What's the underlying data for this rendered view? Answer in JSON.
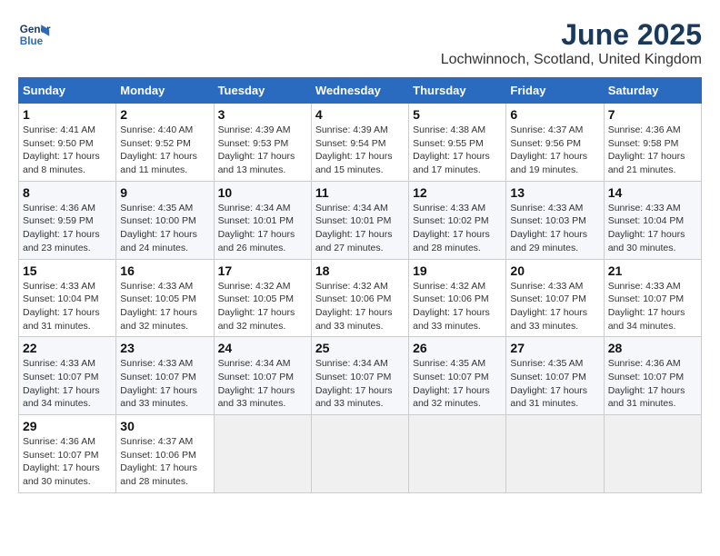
{
  "header": {
    "logo_line1": "General",
    "logo_line2": "Blue",
    "month": "June 2025",
    "location": "Lochwinnoch, Scotland, United Kingdom"
  },
  "weekdays": [
    "Sunday",
    "Monday",
    "Tuesday",
    "Wednesday",
    "Thursday",
    "Friday",
    "Saturday"
  ],
  "weeks": [
    [
      {
        "day": "1",
        "rise": "4:41 AM",
        "set": "9:50 PM",
        "daylight": "17 hours and 8 minutes."
      },
      {
        "day": "2",
        "rise": "4:40 AM",
        "set": "9:52 PM",
        "daylight": "17 hours and 11 minutes."
      },
      {
        "day": "3",
        "rise": "4:39 AM",
        "set": "9:53 PM",
        "daylight": "17 hours and 13 minutes."
      },
      {
        "day": "4",
        "rise": "4:39 AM",
        "set": "9:54 PM",
        "daylight": "17 hours and 15 minutes."
      },
      {
        "day": "5",
        "rise": "4:38 AM",
        "set": "9:55 PM",
        "daylight": "17 hours and 17 minutes."
      },
      {
        "day": "6",
        "rise": "4:37 AM",
        "set": "9:56 PM",
        "daylight": "17 hours and 19 minutes."
      },
      {
        "day": "7",
        "rise": "4:36 AM",
        "set": "9:58 PM",
        "daylight": "17 hours and 21 minutes."
      }
    ],
    [
      {
        "day": "8",
        "rise": "4:36 AM",
        "set": "9:59 PM",
        "daylight": "17 hours and 23 minutes."
      },
      {
        "day": "9",
        "rise": "4:35 AM",
        "set": "10:00 PM",
        "daylight": "17 hours and 24 minutes."
      },
      {
        "day": "10",
        "rise": "4:34 AM",
        "set": "10:01 PM",
        "daylight": "17 hours and 26 minutes."
      },
      {
        "day": "11",
        "rise": "4:34 AM",
        "set": "10:01 PM",
        "daylight": "17 hours and 27 minutes."
      },
      {
        "day": "12",
        "rise": "4:33 AM",
        "set": "10:02 PM",
        "daylight": "17 hours and 28 minutes."
      },
      {
        "day": "13",
        "rise": "4:33 AM",
        "set": "10:03 PM",
        "daylight": "17 hours and 29 minutes."
      },
      {
        "day": "14",
        "rise": "4:33 AM",
        "set": "10:04 PM",
        "daylight": "17 hours and 30 minutes."
      }
    ],
    [
      {
        "day": "15",
        "rise": "4:33 AM",
        "set": "10:04 PM",
        "daylight": "17 hours and 31 minutes."
      },
      {
        "day": "16",
        "rise": "4:33 AM",
        "set": "10:05 PM",
        "daylight": "17 hours and 32 minutes."
      },
      {
        "day": "17",
        "rise": "4:32 AM",
        "set": "10:05 PM",
        "daylight": "17 hours and 32 minutes."
      },
      {
        "day": "18",
        "rise": "4:32 AM",
        "set": "10:06 PM",
        "daylight": "17 hours and 33 minutes."
      },
      {
        "day": "19",
        "rise": "4:32 AM",
        "set": "10:06 PM",
        "daylight": "17 hours and 33 minutes."
      },
      {
        "day": "20",
        "rise": "4:33 AM",
        "set": "10:07 PM",
        "daylight": "17 hours and 33 minutes."
      },
      {
        "day": "21",
        "rise": "4:33 AM",
        "set": "10:07 PM",
        "daylight": "17 hours and 34 minutes."
      }
    ],
    [
      {
        "day": "22",
        "rise": "4:33 AM",
        "set": "10:07 PM",
        "daylight": "17 hours and 34 minutes."
      },
      {
        "day": "23",
        "rise": "4:33 AM",
        "set": "10:07 PM",
        "daylight": "17 hours and 33 minutes."
      },
      {
        "day": "24",
        "rise": "4:34 AM",
        "set": "10:07 PM",
        "daylight": "17 hours and 33 minutes."
      },
      {
        "day": "25",
        "rise": "4:34 AM",
        "set": "10:07 PM",
        "daylight": "17 hours and 33 minutes."
      },
      {
        "day": "26",
        "rise": "4:35 AM",
        "set": "10:07 PM",
        "daylight": "17 hours and 32 minutes."
      },
      {
        "day": "27",
        "rise": "4:35 AM",
        "set": "10:07 PM",
        "daylight": "17 hours and 31 minutes."
      },
      {
        "day": "28",
        "rise": "4:36 AM",
        "set": "10:07 PM",
        "daylight": "17 hours and 31 minutes."
      }
    ],
    [
      {
        "day": "29",
        "rise": "4:36 AM",
        "set": "10:07 PM",
        "daylight": "17 hours and 30 minutes."
      },
      {
        "day": "30",
        "rise": "4:37 AM",
        "set": "10:06 PM",
        "daylight": "17 hours and 28 minutes."
      },
      null,
      null,
      null,
      null,
      null
    ]
  ],
  "labels": {
    "sunrise": "Sunrise:",
    "sunset": "Sunset:",
    "daylight": "Daylight:"
  }
}
